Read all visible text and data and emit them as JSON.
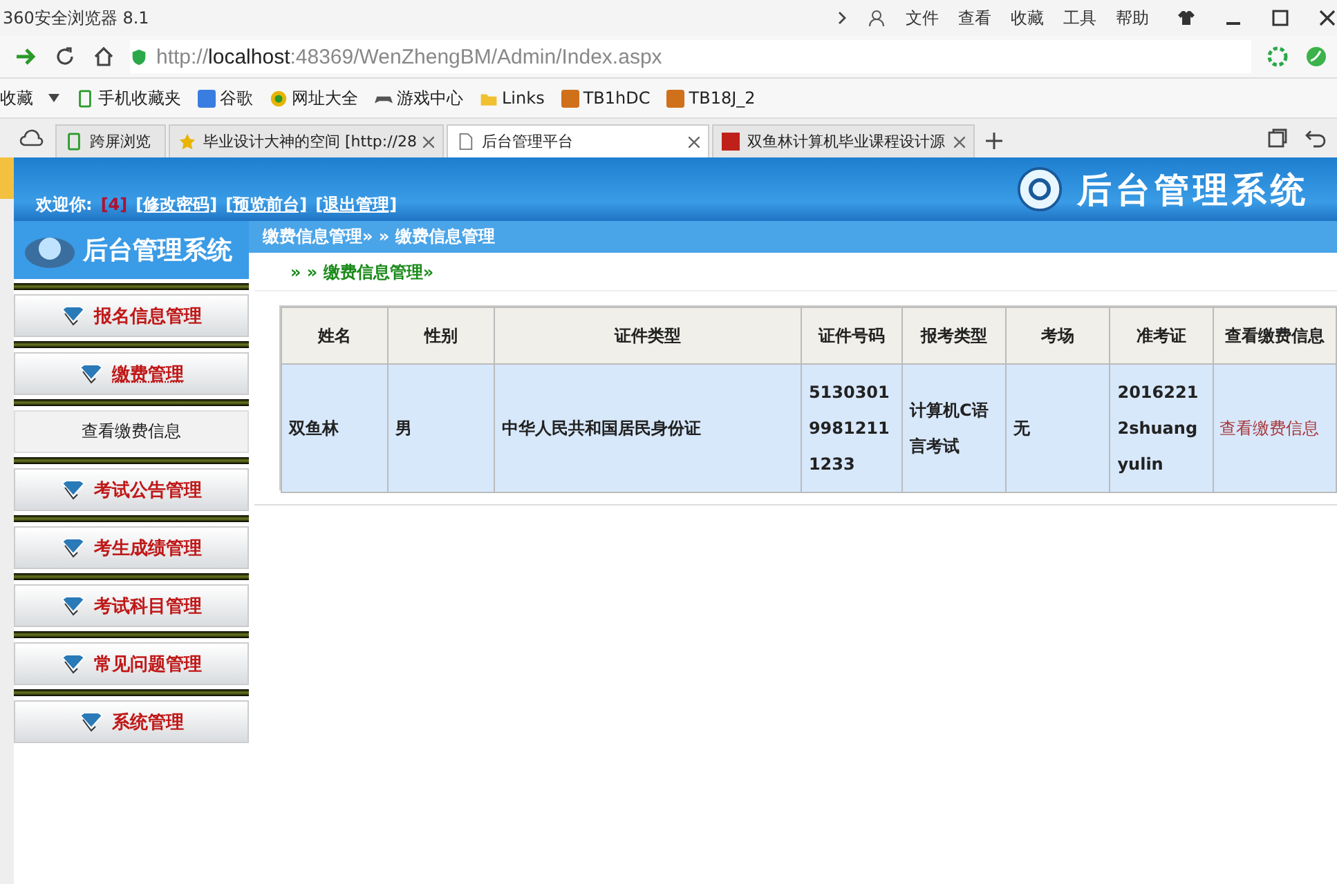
{
  "browser": {
    "title": "360安全浏览器 8.1",
    "menu": [
      "文件",
      "查看",
      "收藏",
      "工具",
      "帮助"
    ],
    "url_prefix": "http://",
    "url_host": "localhost",
    "url_rest": ":48369/WenZhengBM/Admin/Index.aspx",
    "bookmarks": [
      {
        "label": "收藏",
        "kind": "menu"
      },
      {
        "label": "手机收藏夹",
        "kind": "phone"
      },
      {
        "label": "谷歌",
        "kind": "g"
      },
      {
        "label": "网址大全",
        "kind": "globe"
      },
      {
        "label": "游戏中心",
        "kind": "game"
      },
      {
        "label": "Links",
        "kind": "folder"
      },
      {
        "label": "TB1hDC",
        "kind": "tb"
      },
      {
        "label": "TB18J_2",
        "kind": "tb"
      }
    ],
    "tabs": [
      {
        "label": "跨屏浏览",
        "kind": "phone",
        "selected": false
      },
      {
        "label": "毕业设计大神的空间 [http://28",
        "kind": "star",
        "selected": false
      },
      {
        "label": "后台管理平台",
        "kind": "page",
        "selected": true
      },
      {
        "label": "双鱼林计算机毕业课程设计源",
        "kind": "tb",
        "selected": false
      }
    ]
  },
  "header": {
    "title": "后台管理系统",
    "welcome": "欢迎你:",
    "user": "[4]",
    "links": [
      "[修改密码]",
      "[预览前台]",
      "[退出管理]"
    ]
  },
  "sidebar": {
    "title": "后台管理系统",
    "items": [
      {
        "label": "报名信息管理",
        "expanded": false
      },
      {
        "label": "缴费管理",
        "expanded": true,
        "children": [
          {
            "label": "查看缴费信息"
          }
        ]
      },
      {
        "label": "考试公告管理",
        "expanded": false
      },
      {
        "label": "考生成绩管理",
        "expanded": false
      },
      {
        "label": "考试科目管理",
        "expanded": false
      },
      {
        "label": "常见问题管理",
        "expanded": false
      },
      {
        "label": "系统管理",
        "expanded": false
      }
    ]
  },
  "breadcrumb": "缴费信息管理» » 缴费信息管理",
  "section_title": "» » 缴费信息管理»",
  "table": {
    "columns": [
      "姓名",
      "性别",
      "证件类型",
      "证件号码",
      "报考类型",
      "考场",
      "准考证",
      "查看缴费信息"
    ],
    "rows": [
      {
        "cells": [
          "双鱼林",
          "男",
          "中华人民共和国居民身份证",
          "513030199812111233",
          "计算机C语言考试",
          "无",
          "20162212shuangyulin"
        ],
        "link": "查看缴费信息"
      }
    ]
  }
}
